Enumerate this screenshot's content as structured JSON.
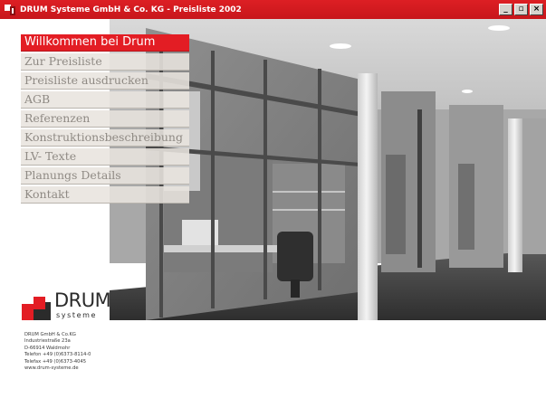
{
  "window": {
    "title": "DRUM Systeme GmbH & Co. KG - Preisliste 2002",
    "buttons": {
      "minimize": "_",
      "restore": "▫",
      "close": "×"
    }
  },
  "nav": {
    "items": [
      {
        "label": "Willkommen bei Drum",
        "active": true
      },
      {
        "label": "Zur Preisliste",
        "active": false
      },
      {
        "label": "Preisliste ausdrucken",
        "active": false
      },
      {
        "label": " AGB",
        "active": false
      },
      {
        "label": "Referenzen",
        "active": false
      },
      {
        "label": "Konstruktionsbeschreibung",
        "active": false
      },
      {
        "label": "LV- Texte",
        "active": false
      },
      {
        "label": "Planungs Details",
        "active": false
      },
      {
        "label": "Kontakt",
        "active": false
      }
    ]
  },
  "logo": {
    "word": "DRUM",
    "sub": "systeme"
  },
  "address": {
    "company": "DRUM GmbH & Co.KG",
    "street": "Industriestraße 23a",
    "city": "D-66914 Waldmohr",
    "phone": "Telefon +49 (0)6373-8114-0",
    "fax": "Telefax +49 (0)6373-4045",
    "web": "www.drum-systeme.de"
  },
  "colors": {
    "brand_red": "#e31d24",
    "title_red": "#d21a1f",
    "menu_bg": "#e8e4de",
    "menu_text": "#8f8a84"
  }
}
